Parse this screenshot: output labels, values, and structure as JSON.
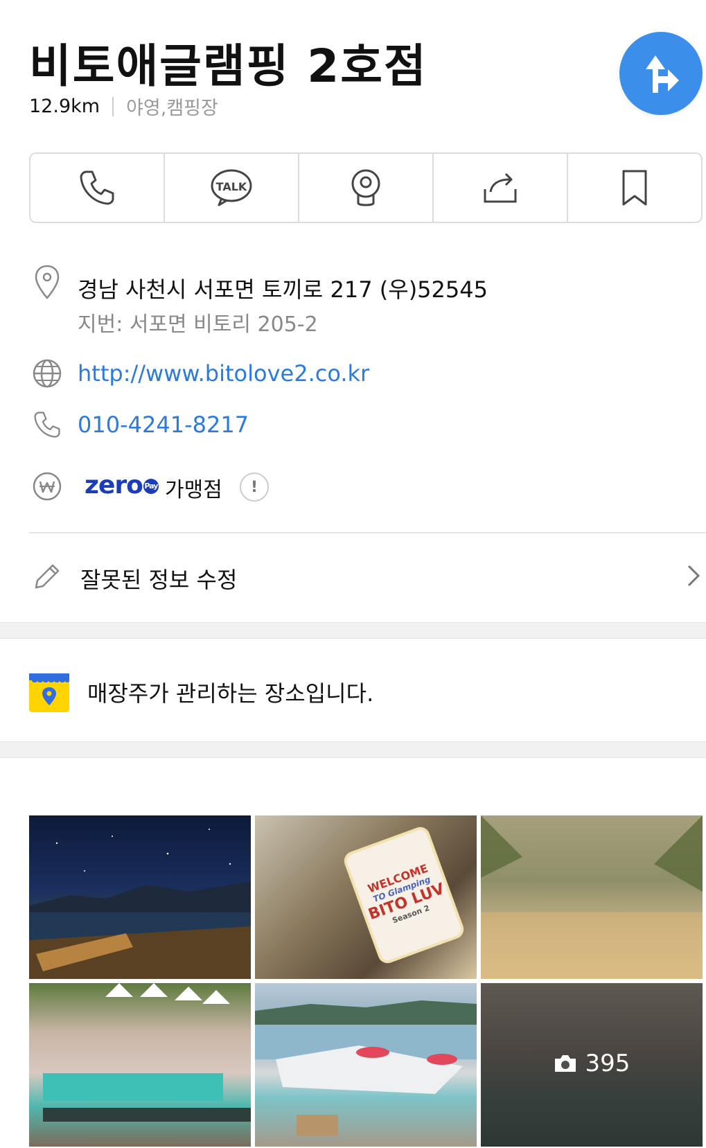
{
  "header": {
    "title": "비토애글램핑 2호점",
    "distance": "12.9km",
    "category": "야영,캠핑장"
  },
  "actions": [
    {
      "icon": "phone-icon"
    },
    {
      "icon": "talk-icon",
      "label": "TALK"
    },
    {
      "icon": "roadview-icon"
    },
    {
      "icon": "share-icon"
    },
    {
      "icon": "bookmark-icon"
    }
  ],
  "info": {
    "address": "경남 사천시 서포면 토끼로 217 (우)52545",
    "jibun": "지번: 서포면 비토리 205-2",
    "website": "http://www.bitolove2.co.kr",
    "phone": "010-4241-8217",
    "zeropay_logo": "zero",
    "zeropay_pay": "Pay",
    "zeropay_label": "가맹점",
    "zeropay_info": "!"
  },
  "edit": {
    "label": "잘못된 정보 수정"
  },
  "owner": {
    "text": "매장주가 관리하는 장소입니다."
  },
  "photos": {
    "count": "395",
    "sign_lines": [
      "WELCOME",
      "TO Glamping",
      "BITO LUV",
      "Season 2"
    ]
  },
  "colors": {
    "accent": "#3B8EEA",
    "link": "#2B7BDE",
    "zeropay": "#1B3DB8",
    "owner_badge": "#FFD400"
  }
}
